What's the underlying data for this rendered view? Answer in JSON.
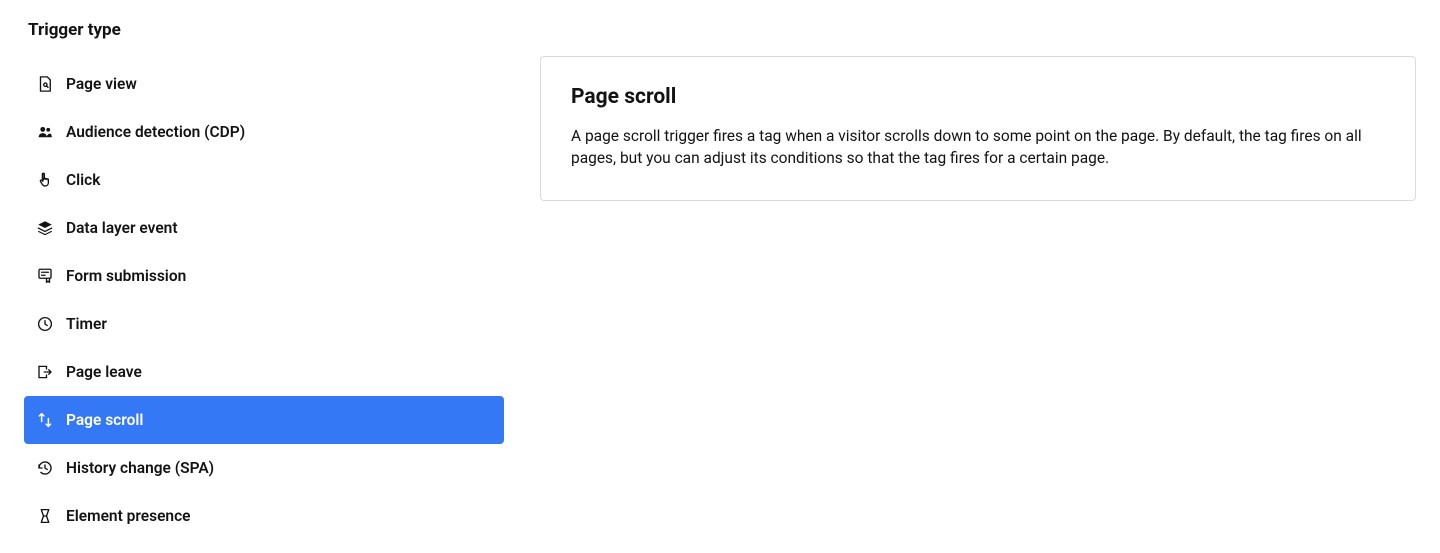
{
  "heading": "Trigger type",
  "triggers": [
    {
      "label": "Page view"
    },
    {
      "label": "Audience detection (CDP)"
    },
    {
      "label": "Click"
    },
    {
      "label": "Data layer event"
    },
    {
      "label": "Form submission"
    },
    {
      "label": "Timer"
    },
    {
      "label": "Page leave"
    },
    {
      "label": "Page scroll"
    },
    {
      "label": "History change (SPA)"
    },
    {
      "label": "Element presence"
    }
  ],
  "detail": {
    "title": "Page scroll",
    "description": "A page scroll trigger fires a tag when a visitor scrolls down to some point on the page. By default, the tag fires on all pages, but you can adjust its conditions so that the tag fires for a certain page."
  }
}
